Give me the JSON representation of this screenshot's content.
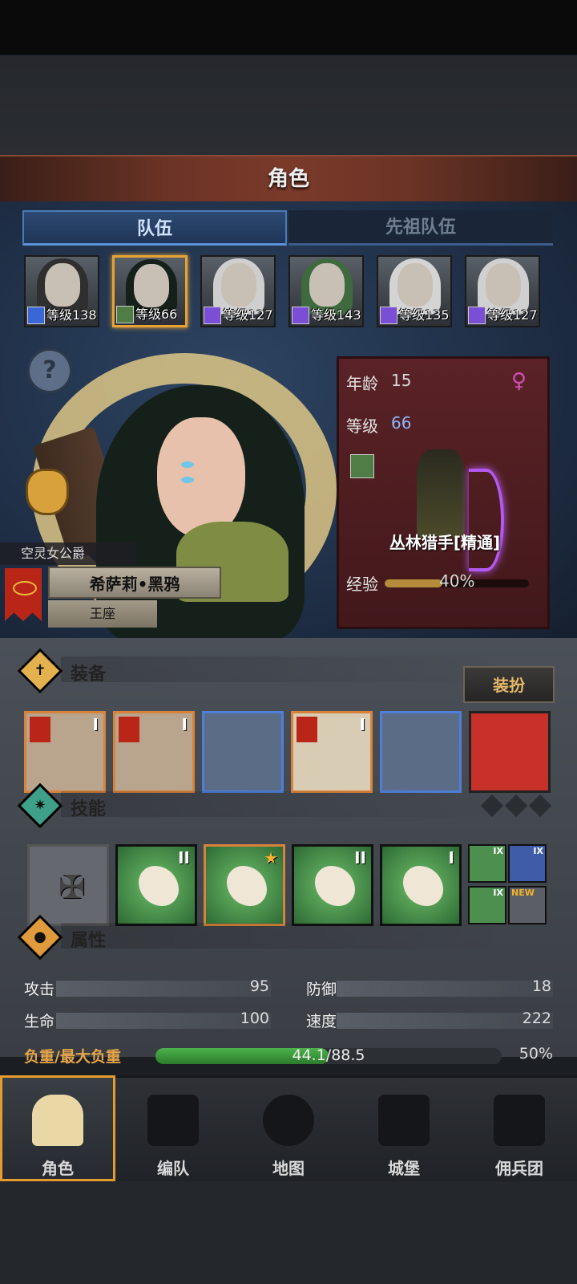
{
  "header": {
    "title": "角色"
  },
  "tabs": [
    {
      "label": "队伍",
      "active": true
    },
    {
      "label": "先祖队伍",
      "active": false
    }
  ],
  "party": [
    {
      "level_text": "等级138",
      "hair": "#2f2f2f",
      "class_color": "#3b67d6"
    },
    {
      "level_text": "等级66",
      "hair": "#142019",
      "class_color": "#4f7d45",
      "selected": true
    },
    {
      "level_text": "等级127",
      "hair": "#cfcfcf",
      "class_color": "#7a4fd6"
    },
    {
      "level_text": "等级143",
      "hair": "#3f6a3e",
      "class_color": "#7a4fd6"
    },
    {
      "level_text": "等级135",
      "hair": "#d4d4d4",
      "class_color": "#7a4fd6"
    },
    {
      "level_text": "等级127",
      "hair": "#d0d0d0",
      "class_color": "#7a4fd6"
    }
  ],
  "hero": {
    "title_tag": "空灵女公爵",
    "name": "希萨莉•黑鸦",
    "throne": "王座"
  },
  "stat_card": {
    "age_label": "年龄",
    "age": "15",
    "level_label": "等级",
    "level": "66",
    "female_icon": "♀",
    "class_name": "丛林猎手[精通]",
    "exp_label": "经验",
    "exp_percent_text": "40%",
    "exp_fraction": 0.4
  },
  "equipment": {
    "title": "装备",
    "dress_button": "装扮",
    "slots": [
      {
        "icon": "bow-icon",
        "rank": "I",
        "flag": true
      },
      {
        "icon": "bow-icon",
        "rank": "I",
        "flag": true
      },
      {
        "icon": "hood-icon",
        "rank": ""
      },
      {
        "icon": "armor-icon",
        "rank": "I",
        "flag": true
      },
      {
        "icon": "boots-icon",
        "rank": ""
      },
      {
        "icon": "phoenix-icon",
        "rank": ""
      }
    ]
  },
  "skills": {
    "title": "技能",
    "slots": [
      {
        "icon": "empty-slot-icon",
        "rank": ""
      },
      {
        "icon": "wolf-icon",
        "rank": "II",
        "badge": "1"
      },
      {
        "icon": "eagle-icon",
        "rank": "★"
      },
      {
        "icon": "sword-icon",
        "rank": "II"
      },
      {
        "icon": "feather-icon",
        "rank": "I"
      }
    ],
    "mini": [
      {
        "icon": "claw-icon",
        "rank": "IX"
      },
      {
        "icon": "bird-icon",
        "rank": "IX"
      },
      {
        "icon": "burst-icon",
        "rank": "IX"
      },
      {
        "icon": "empty-slot-icon",
        "rank": "NEW"
      }
    ]
  },
  "attributes": {
    "title": "属性",
    "items": [
      {
        "label": "攻击",
        "value": "95"
      },
      {
        "label": "防御",
        "value": "18"
      },
      {
        "label": "生命",
        "value": "100"
      },
      {
        "label": "速度",
        "value": "222"
      }
    ],
    "load_label": "负重/最大负重",
    "load_text": "44.1/88.5",
    "load_percent": "50%",
    "load_fraction": 0.5
  },
  "nav": [
    {
      "label": "角色",
      "selected": true
    },
    {
      "label": "编队"
    },
    {
      "label": "地图"
    },
    {
      "label": "城堡"
    },
    {
      "label": "佣兵团"
    }
  ],
  "colors": {
    "accent": "#e69b2e",
    "exp": "#b68b3c",
    "load": "#3a9a3a"
  }
}
